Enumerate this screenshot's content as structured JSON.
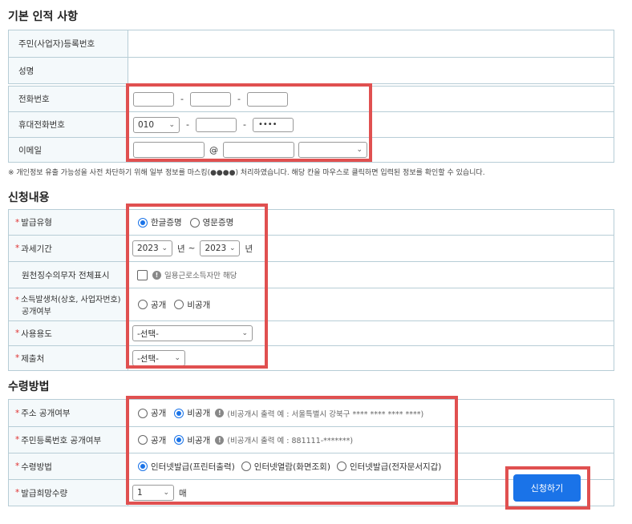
{
  "sections": {
    "basic": "기본 인적 사항",
    "apply": "신청내용",
    "receive": "수령방법"
  },
  "basic": {
    "rrn_label": "주민(사업자)등록번호",
    "name_label": "성명",
    "phone_label": "전화번호",
    "mobile_label": "휴대전화번호",
    "mobile_prefix": "010",
    "mobile_masked": "••••",
    "email_label": "이메일",
    "email_at": "@",
    "dash": "-"
  },
  "notice": "※ 개인정보 유출 가능성을 사전 차단하기 위해 일부 정보를 마스킹(●●●●) 처리하였습니다. 해당 칸을 마우스로 클릭하면 입력된 정보를 확인할 수 있습니다.",
  "apply": {
    "issue_type_label": "발급유형",
    "issue_type_options": [
      "한글증명",
      "영문증명"
    ],
    "period_label": "과세기간",
    "period_from": "2023",
    "period_to": "2023",
    "year_unit": "년",
    "tilde": "~",
    "withholder_label": "원천징수의무자 전체표시",
    "withholder_hint": "일용근로소득자만 해당",
    "source_label_1": "소득발생처(상호, 사업자번호)",
    "source_label_2": "공개여부",
    "source_options": [
      "공개",
      "비공개"
    ],
    "purpose_label": "사용용도",
    "purpose_value": "-선택-",
    "submit_to_label": "제출처",
    "submit_to_value": "-선택-"
  },
  "receive": {
    "address_label": "주소 공개여부",
    "address_options": [
      "공개",
      "비공개"
    ],
    "address_hint": "(비공개시 출력 예 : 서울특별시 강북구 **** **** **** ****)",
    "rrn_label": "주민등록번호 공개여부",
    "rrn_options": [
      "공개",
      "비공개"
    ],
    "rrn_hint": "(비공개시 출력 예 : 881111-*******)",
    "method_label": "수령방법",
    "method_options": [
      "인터넷발급(프린터출력)",
      "인터넷열람(화면조회)",
      "인터넷발급(전자문서지갑)"
    ],
    "copies_label": "발급희망수량",
    "copies_value": "1",
    "copies_unit": "매"
  },
  "submit_button": "신청하기",
  "colors": {
    "accent": "#1a73e8",
    "highlight": "#e05050",
    "required": "#e03131"
  }
}
